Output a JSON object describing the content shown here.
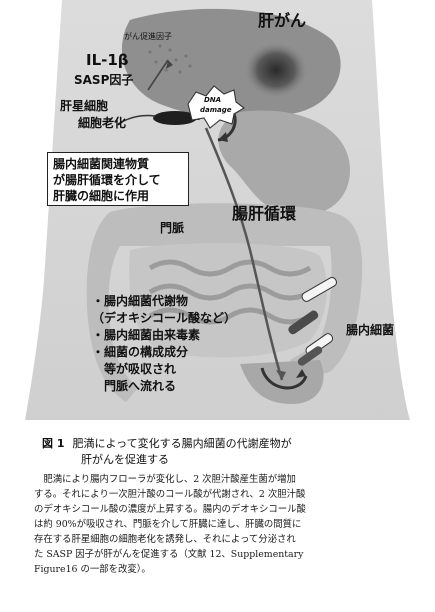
{
  "figure": {
    "labels": {
      "liver_cancer": "肝がん",
      "cancer_promoting_factors": "がん促進因子",
      "il1b": "IL-1β",
      "sasp_factor": "SASP因子",
      "stellate_cell": "肝星細胞",
      "cell_senescence": "細胞老化",
      "dna_damage_1": "DNA",
      "dna_damage_2": "damage",
      "portal_vein": "門脈",
      "enterohepatic_circulation": "腸肝循環",
      "gut_bacteria": "腸内細菌"
    },
    "callout_lines": [
      "腸内細菌関連物質",
      "が腸肝循環を介して",
      "肝臓の細胞に作用"
    ],
    "bullet_lines": [
      "・腸内細菌代謝物",
      "（デオキシコール酸など）",
      "・腸内細菌由来毒素",
      "・細菌の構成成分",
      "　等が吸収され",
      "　門脈へ流れる"
    ]
  },
  "caption": {
    "number": "図 1",
    "title_line1": "肥満によって変化する腸内細菌の代謝産物が",
    "title_line2": "肝がんを促進する",
    "body_lines": [
      "　肥満により腸内フローラが変化し、2 次胆汁酸産生菌が増加",
      "する。それにより一次胆汁酸のコール酸が代謝され、2 次胆汁酸",
      "のデオキシコール酸の濃度が上昇する。腸内のデオキシコール酸",
      "は約 90%が吸収され、門脈を介して肝臓に達し、肝臓の間質に",
      "存在する肝星細胞の細胞老化を誘発し、それによって分泌され",
      "た SASP 因子が肝がんを促進する（文献 12、Supplementary",
      "Figure16 の一部を改変）。"
    ]
  }
}
